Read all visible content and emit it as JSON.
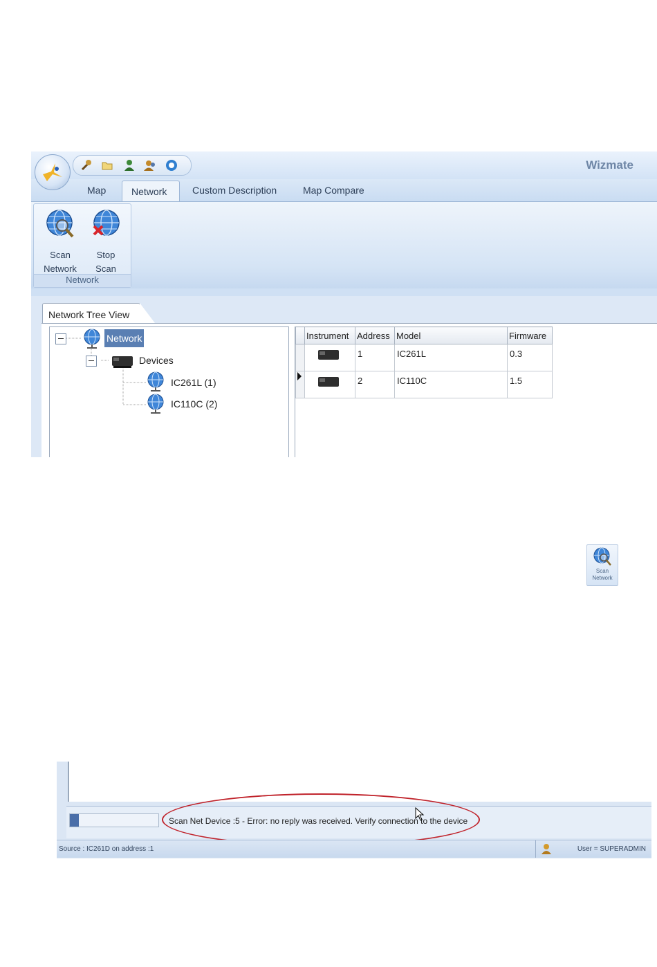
{
  "app": {
    "title": "Wizmate"
  },
  "tabs": [
    {
      "label": "Map"
    },
    {
      "label": "Network"
    },
    {
      "label": "Custom Description"
    },
    {
      "label": "Map Compare"
    }
  ],
  "ribbon": {
    "scan_network": "Scan Network",
    "scan_line1": "Scan",
    "scan_line2": "Network",
    "stop_line1": "Stop",
    "stop_line2": "Scan",
    "group_label": "Network"
  },
  "document_tab": "Network Tree View",
  "tree": {
    "root": "Network",
    "devices": "Devices",
    "children": [
      "IC261L (1)",
      "IC110C (2)"
    ]
  },
  "grid": {
    "columns": [
      "Instrument",
      "Address",
      "Model",
      "Firmware"
    ],
    "rows": [
      {
        "address": "1",
        "model": "IC261L",
        "firmware": "0.3"
      },
      {
        "address": "2",
        "model": "IC110C",
        "firmware": "1.5"
      }
    ]
  },
  "mini_scan": {
    "line1": "Scan",
    "line2": "Network"
  },
  "status": {
    "message": "Scan Net Device :5 - Error: no reply was received. Verify connection to the device",
    "source": "Source : IC261D on address :1",
    "user": "User = SUPERADMIN",
    "progress": 0.1
  },
  "colors": {
    "selection": "#5a7fb3",
    "highlight_ellipse": "#c0232b"
  }
}
